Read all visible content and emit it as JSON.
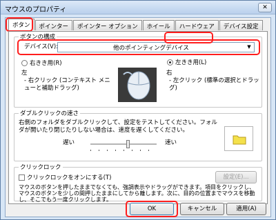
{
  "window": {
    "title": "マウスのプロパティ",
    "close_label": "✕"
  },
  "tabs": [
    {
      "label": "ボタン"
    },
    {
      "label": "ポインター"
    },
    {
      "label": "ポインター オプション"
    },
    {
      "label": "ホイール"
    },
    {
      "label": "ハードウェア"
    },
    {
      "label": "デバイス設定"
    }
  ],
  "button_config": {
    "group_label": "ボタンの構成",
    "device_label": "デバイス(V):",
    "device_value": "他のポインティングデバイス",
    "right_handed_label": "右きき用(R)",
    "left_handed_label": "左きき用(L)",
    "left_side_title": "左",
    "left_side_desc": "- 右クリック (コンテキスト メニューと補助ドラッグ)",
    "right_side_title": "右",
    "right_side_desc": "- 左クリック (標準の選択とドラッグ)",
    "selected": "left"
  },
  "double_click": {
    "group_label": "ダブルクリックの速さ",
    "description": "右側のフォルダをダブルクリックして、設定をテストしてください。フォルダが開いたり閉じたりしない場合は、速度を遅くしてください。",
    "slow_label": "遅い",
    "fast_label": "速い",
    "speed_fraction": 0.57
  },
  "click_lock": {
    "group_label": "クリックロック",
    "checkbox_label": "クリックロックをオンにする(T)",
    "checked": false,
    "settings_label": "設定(E)...",
    "description": "マウスのボタンを押したままでなくても、強調表示やドラッグができます。項目をクリックし、マウスのボタンを少しの間押したままにしてから離します。次に、目的の位置までマウスを移動し、そこでもう一度クリックします。"
  },
  "footer": {
    "ok_label": "OK",
    "cancel_label": "キャンセル",
    "apply_label": "適用(A)"
  },
  "colors": {
    "highlight": "#ff1d1d",
    "folder": "#f4e14b"
  }
}
